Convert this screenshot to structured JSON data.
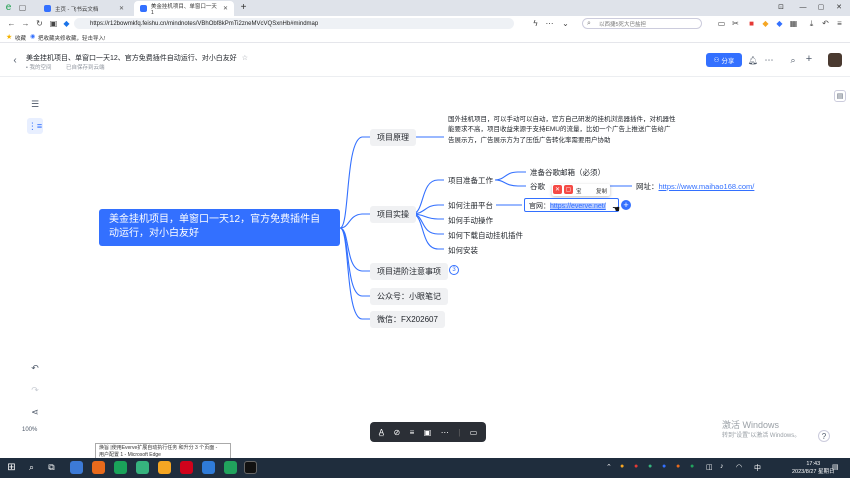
{
  "browser": {
    "tabs": [
      {
        "label": "主页 - 飞书云文档"
      },
      {
        "label": "美金挂机项目、单窗口一天1"
      }
    ],
    "url": "https://r12bowmkfq.feishu.cn/mindnotes/VBhObf8kPmTi2zneMVcVQSxnHb#mindmap",
    "search_placeholder": "以西捷5死大巴盐担",
    "bookmarks": [
      {
        "label": "收藏"
      },
      {
        "label": "把收藏夹修收藏，轻击导入!"
      }
    ]
  },
  "doc": {
    "title": "美金挂机项目、单窗口一天12、官方免费插件自动运行、对小白友好",
    "path": "我的空间",
    "saved": "已自保存到云端",
    "share_label": "分享"
  },
  "mindmap": {
    "root": "美金挂机项目，单窗口一天12，官方免费插件自动运行，对小白友好",
    "branches": [
      {
        "label": "项目原理"
      },
      {
        "label": "项目实操"
      },
      {
        "label": "项目进阶注意事项"
      },
      {
        "label": "公众号：小眼笔记"
      },
      {
        "label": "微信：FX202607"
      }
    ],
    "principle_desc": "国外挂机项目，可以手动可以自动，官方自己研发的挂机浏览器插件，对机器性能要求不高，项目收益来源于支持EMU的流量，比如一个广告上推送广告给广告展示方，广告展示方为了压低广告转化率需要用户协助",
    "practice_children": [
      {
        "label": "项目准备工作"
      },
      {
        "label": "如何注册平台"
      },
      {
        "label": "如何手动操作"
      },
      {
        "label": "如何下载自动挂机插件"
      },
      {
        "label": "如何安装"
      }
    ],
    "prep_children": [
      {
        "label": "准备谷歌邮箱（必须）"
      },
      {
        "label": "谷歌"
      }
    ],
    "website_prefix": "网址：",
    "website_url": "https://www.maihao168.com/",
    "official_prefix": "官网：",
    "official_url": "https://everve.net/",
    "float_toolbar_label": "复制",
    "float_toolbar_left": "宝",
    "collapsed_count": "3"
  },
  "zoom": "100%",
  "tooltip": {
    "line1": "焕旨 |使用Everve扩展自动执行任务 和升分 3 个页面 -",
    "line2": "用户配置 1 - Microsoft Edge"
  },
  "activation": {
    "title": "激活 Windows",
    "subtitle": "转到\"设置\"以激活 Windows。"
  },
  "taskbar": {
    "time": "17:43",
    "date": "2023/8/27 星期日",
    "lang": "中"
  }
}
